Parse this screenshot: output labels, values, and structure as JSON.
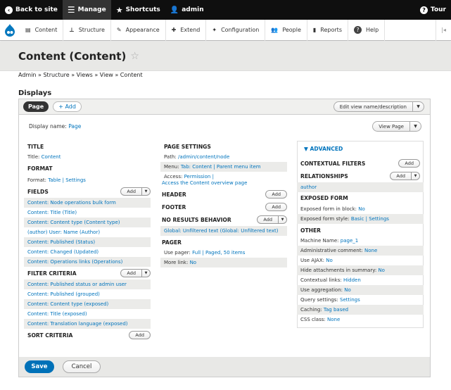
{
  "toolbar": {
    "back": "Back to site",
    "manage": "Manage",
    "shortcuts": "Shortcuts",
    "user": "admin",
    "tour": "Tour"
  },
  "tray": {
    "items": [
      "Content",
      "Structure",
      "Appearance",
      "Extend",
      "Configuration",
      "People",
      "Reports",
      "Help"
    ]
  },
  "page": {
    "title": "Content (Content)",
    "breadcrumb": "Admin » Structure » Views » View » Content",
    "displays_heading": "Displays"
  },
  "tabs": {
    "page": "Page",
    "add": "+ Add",
    "edit_view": "Edit view name/description"
  },
  "display": {
    "label": "Display name:",
    "value": "Page",
    "view_page": "View Page"
  },
  "col1": {
    "title_h": "TITLE",
    "title_label": "Title:",
    "title_value": "Content",
    "format_h": "FORMAT",
    "format_label": "Format:",
    "format_value": "Table",
    "format_sep": "|",
    "format_settings": "Settings",
    "fields_h": "FIELDS",
    "add": "Add",
    "fields": [
      "Content: Node operations bulk form",
      "Content: Title (Title)",
      "Content: Content type (Content type)",
      "(author) User: Name (Author)",
      "Content: Published (Status)",
      "Content: Changed (Updated)",
      "Content: Operations links (Operations)"
    ],
    "filter_h": "FILTER CRITERIA",
    "filters": [
      "Content: Published status or admin user",
      "Content: Published (grouped)",
      "Content: Content type (exposed)",
      "Content: Title (exposed)",
      "Content: Translation language (exposed)"
    ],
    "sort_h": "SORT CRITERIA"
  },
  "col2": {
    "page_settings_h": "PAGE SETTINGS",
    "path_label": "Path:",
    "path_value": "/admin/content/node",
    "menu_label": "Menu:",
    "menu_value": "Tab: Content",
    "menu_sep": "|",
    "menu_parent": "Parent menu item",
    "access_label": "Access:",
    "access_value": "Permission",
    "access_sep": "|",
    "access_overview": "Access the Content overview page",
    "header_h": "HEADER",
    "footer_h": "FOOTER",
    "noresults_h": "NO RESULTS BEHAVIOR",
    "noresults_item": "Global: Unfiltered text (Global: Unfiltered text)",
    "pager_h": "PAGER",
    "pager_label": "Use pager:",
    "pager_value": "Full",
    "pager_sep": "|",
    "pager_items": "Paged, 50 items",
    "morelink_label": "More link:",
    "morelink_value": "No",
    "add": "Add"
  },
  "col3": {
    "advanced": "▼ ADVANCED",
    "contextual_h": "CONTEXTUAL FILTERS",
    "relationships_h": "RELATIONSHIPS",
    "relationship_item": "author",
    "exposed_h": "EXPOSED FORM",
    "exposed_block_label": "Exposed form in block:",
    "exposed_block_value": "No",
    "exposed_style_label": "Exposed form style:",
    "exposed_style_value": "Basic",
    "exposed_style_sep": "|",
    "exposed_style_settings": "Settings",
    "other_h": "OTHER",
    "other": [
      {
        "label": "Machine Name:",
        "value": "page_1"
      },
      {
        "label": "Administrative comment:",
        "value": "None"
      },
      {
        "label": "Use AJAX:",
        "value": "No"
      },
      {
        "label": "Hide attachments in summary:",
        "value": "No"
      },
      {
        "label": "Contextual links:",
        "value": "Hidden"
      },
      {
        "label": "Use aggregation:",
        "value": "No"
      },
      {
        "label": "Query settings:",
        "value": "Settings"
      },
      {
        "label": "Caching:",
        "value": "Tag based"
      },
      {
        "label": "CSS class:",
        "value": "None"
      }
    ],
    "add": "Add"
  },
  "actions": {
    "save": "Save",
    "cancel": "Cancel"
  }
}
